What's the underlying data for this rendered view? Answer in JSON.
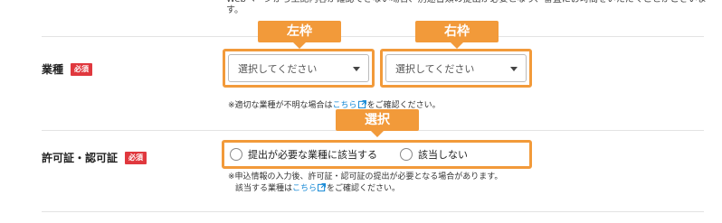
{
  "top_note": "Webページから上記内容が確認できない場合、別途書類の提出が必要となり、審査にお時間をいただくことがございます。",
  "industry": {
    "label": "業種",
    "required_badge": "必須",
    "callout_left": "左枠",
    "callout_right": "右枠",
    "select_left_placeholder": "選択してください",
    "select_right_placeholder": "選択してください",
    "note_prefix": "※適切な業種が不明な場合は",
    "note_link": "こちら",
    "note_suffix": "をご確認ください。"
  },
  "license": {
    "label": "許可証・認可証",
    "required_badge": "必須",
    "callout": "選択",
    "options": [
      "提出が必要な業種に該当する",
      "該当しない"
    ],
    "note_line1": "※申込情報の入力後、許可証・認可証の提出が必要となる場合があります。",
    "note_line2_prefix": "該当する業種は",
    "note_line2_link": "こちら",
    "note_line2_suffix": "をご確認ください。"
  },
  "icons": {
    "external_link": "external-link-icon",
    "dropdown": "chevron-down-icon"
  },
  "colors": {
    "accent_orange": "#f29a3a",
    "required_red": "#e0383e",
    "link_blue": "#1a8bd6"
  }
}
